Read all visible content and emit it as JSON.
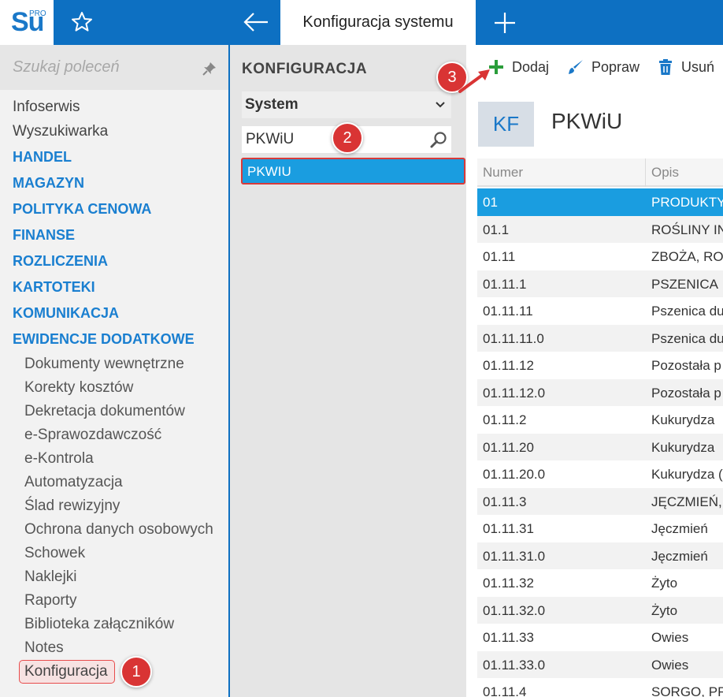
{
  "colors": {
    "brand_blue": "#0d70c2",
    "accent_blue": "#1a9de0",
    "section_blue": "#1a7fd0",
    "callout_red": "#d93434",
    "add_green": "#2a9d3a"
  },
  "header": {
    "logo": "Su",
    "logo_badge": "PRO",
    "active_tab": "Konfiguracja systemu",
    "icons": [
      "star-icon",
      "arrow-left-icon",
      "plus-icon"
    ]
  },
  "sidebar": {
    "search_placeholder": "Szukaj poleceń",
    "items": [
      "Infoserwis",
      "Wyszukiwarka"
    ],
    "sections": [
      "HANDEL",
      "MAGAZYN",
      "POLITYKA CENOWA",
      "FINANSE",
      "ROZLICZENIA",
      "KARTOTEKI",
      "KOMUNIKACJA",
      "EWIDENCJE DODATKOWE"
    ],
    "subitems": [
      "Dokumenty wewnętrzne",
      "Korekty kosztów",
      "Dekretacja dokumentów",
      "e-Sprawozdawczość",
      "e-Kontrola",
      "Automatyzacja",
      "Ślad rewizyjny",
      "Ochrona danych osobowych",
      "Schowek",
      "Naklejki",
      "Raporty",
      "Biblioteka załączników",
      "Notes"
    ],
    "active_item": "Konfiguracja"
  },
  "config_panel": {
    "title": "KONFIGURACJA",
    "select_value": "System",
    "search_value": "PKWiU",
    "result": "PKWIU"
  },
  "toolbar": {
    "add_label": "Dodaj",
    "edit_label": "Popraw",
    "delete_label": "Usuń"
  },
  "content": {
    "badge": "KF",
    "title": "PKWiU"
  },
  "table": {
    "columns": [
      "Numer",
      "Opis"
    ],
    "rows": [
      [
        "01",
        "PRODUKTY"
      ],
      [
        "01.1",
        "ROŚLINY IN"
      ],
      [
        "01.11",
        "ZBOŻA, ROŚ"
      ],
      [
        "01.11.1",
        "PSZENICA"
      ],
      [
        "01.11.11",
        "Pszenica du"
      ],
      [
        "01.11.11.0",
        "Pszenica du"
      ],
      [
        "01.11.12",
        "Pozostała p"
      ],
      [
        "01.11.12.0",
        "Pozostała p"
      ],
      [
        "01.11.2",
        "Kukurydza"
      ],
      [
        "01.11.20",
        "Kukurydza"
      ],
      [
        "01.11.20.0",
        "Kukurydza ("
      ],
      [
        "01.11.3",
        "JĘCZMIEŃ, Ż"
      ],
      [
        "01.11.31",
        "Jęczmień"
      ],
      [
        "01.11.31.0",
        "Jęczmień"
      ],
      [
        "01.11.32",
        "Żyto"
      ],
      [
        "01.11.32.0",
        "Żyto"
      ],
      [
        "01.11.33",
        "Owies"
      ],
      [
        "01.11.33.0",
        "Owies"
      ],
      [
        "01.11.4",
        "SORGO, PR"
      ]
    ]
  },
  "callouts": [
    "1",
    "2",
    "3"
  ]
}
